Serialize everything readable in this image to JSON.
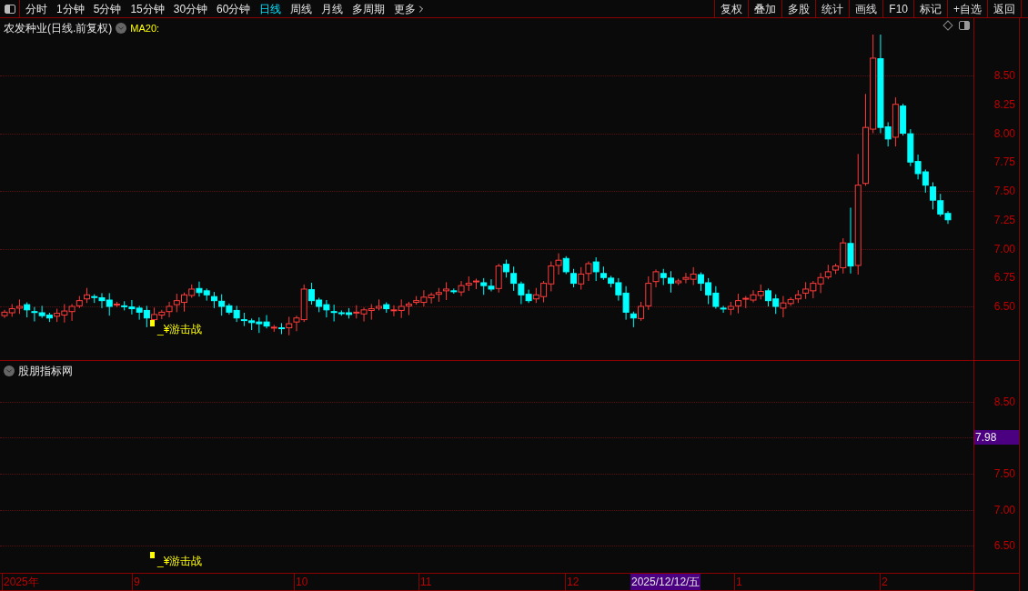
{
  "toolbar": {
    "periods": [
      {
        "label": "分时",
        "selected": false
      },
      {
        "label": "1分钟",
        "selected": false
      },
      {
        "label": "5分钟",
        "selected": false
      },
      {
        "label": "15分钟",
        "selected": false
      },
      {
        "label": "30分钟",
        "selected": false
      },
      {
        "label": "60分钟",
        "selected": false
      },
      {
        "label": "日线",
        "selected": true
      },
      {
        "label": "周线",
        "selected": false
      },
      {
        "label": "月线",
        "selected": false
      },
      {
        "label": "多周期",
        "selected": false
      }
    ],
    "more": "更多",
    "actions": [
      "复权",
      "叠加",
      "多股",
      "统计",
      "画线",
      "F10",
      "标记",
      "+自选",
      "返回"
    ]
  },
  "main_chart": {
    "title": "农发种业(日线.前复权)",
    "indicator": "MA20:",
    "y_ticks": [
      "8.50",
      "8.25",
      "8.00",
      "7.75",
      "7.50",
      "7.25",
      "7.00",
      "6.75",
      "6.50"
    ],
    "signal_label": "_¥游击战"
  },
  "sub_chart": {
    "title": "股朋指标网",
    "y_ticks": [
      "8.50",
      "7.50",
      "7.00",
      "6.50"
    ],
    "cursor_value": "7.98",
    "signal_label": "_¥游击战"
  },
  "x_axis": {
    "labels": [
      "2025年",
      "9",
      "10",
      "11",
      "12",
      "1",
      "2"
    ],
    "cursor_date": "2025/12/12/五"
  }
}
